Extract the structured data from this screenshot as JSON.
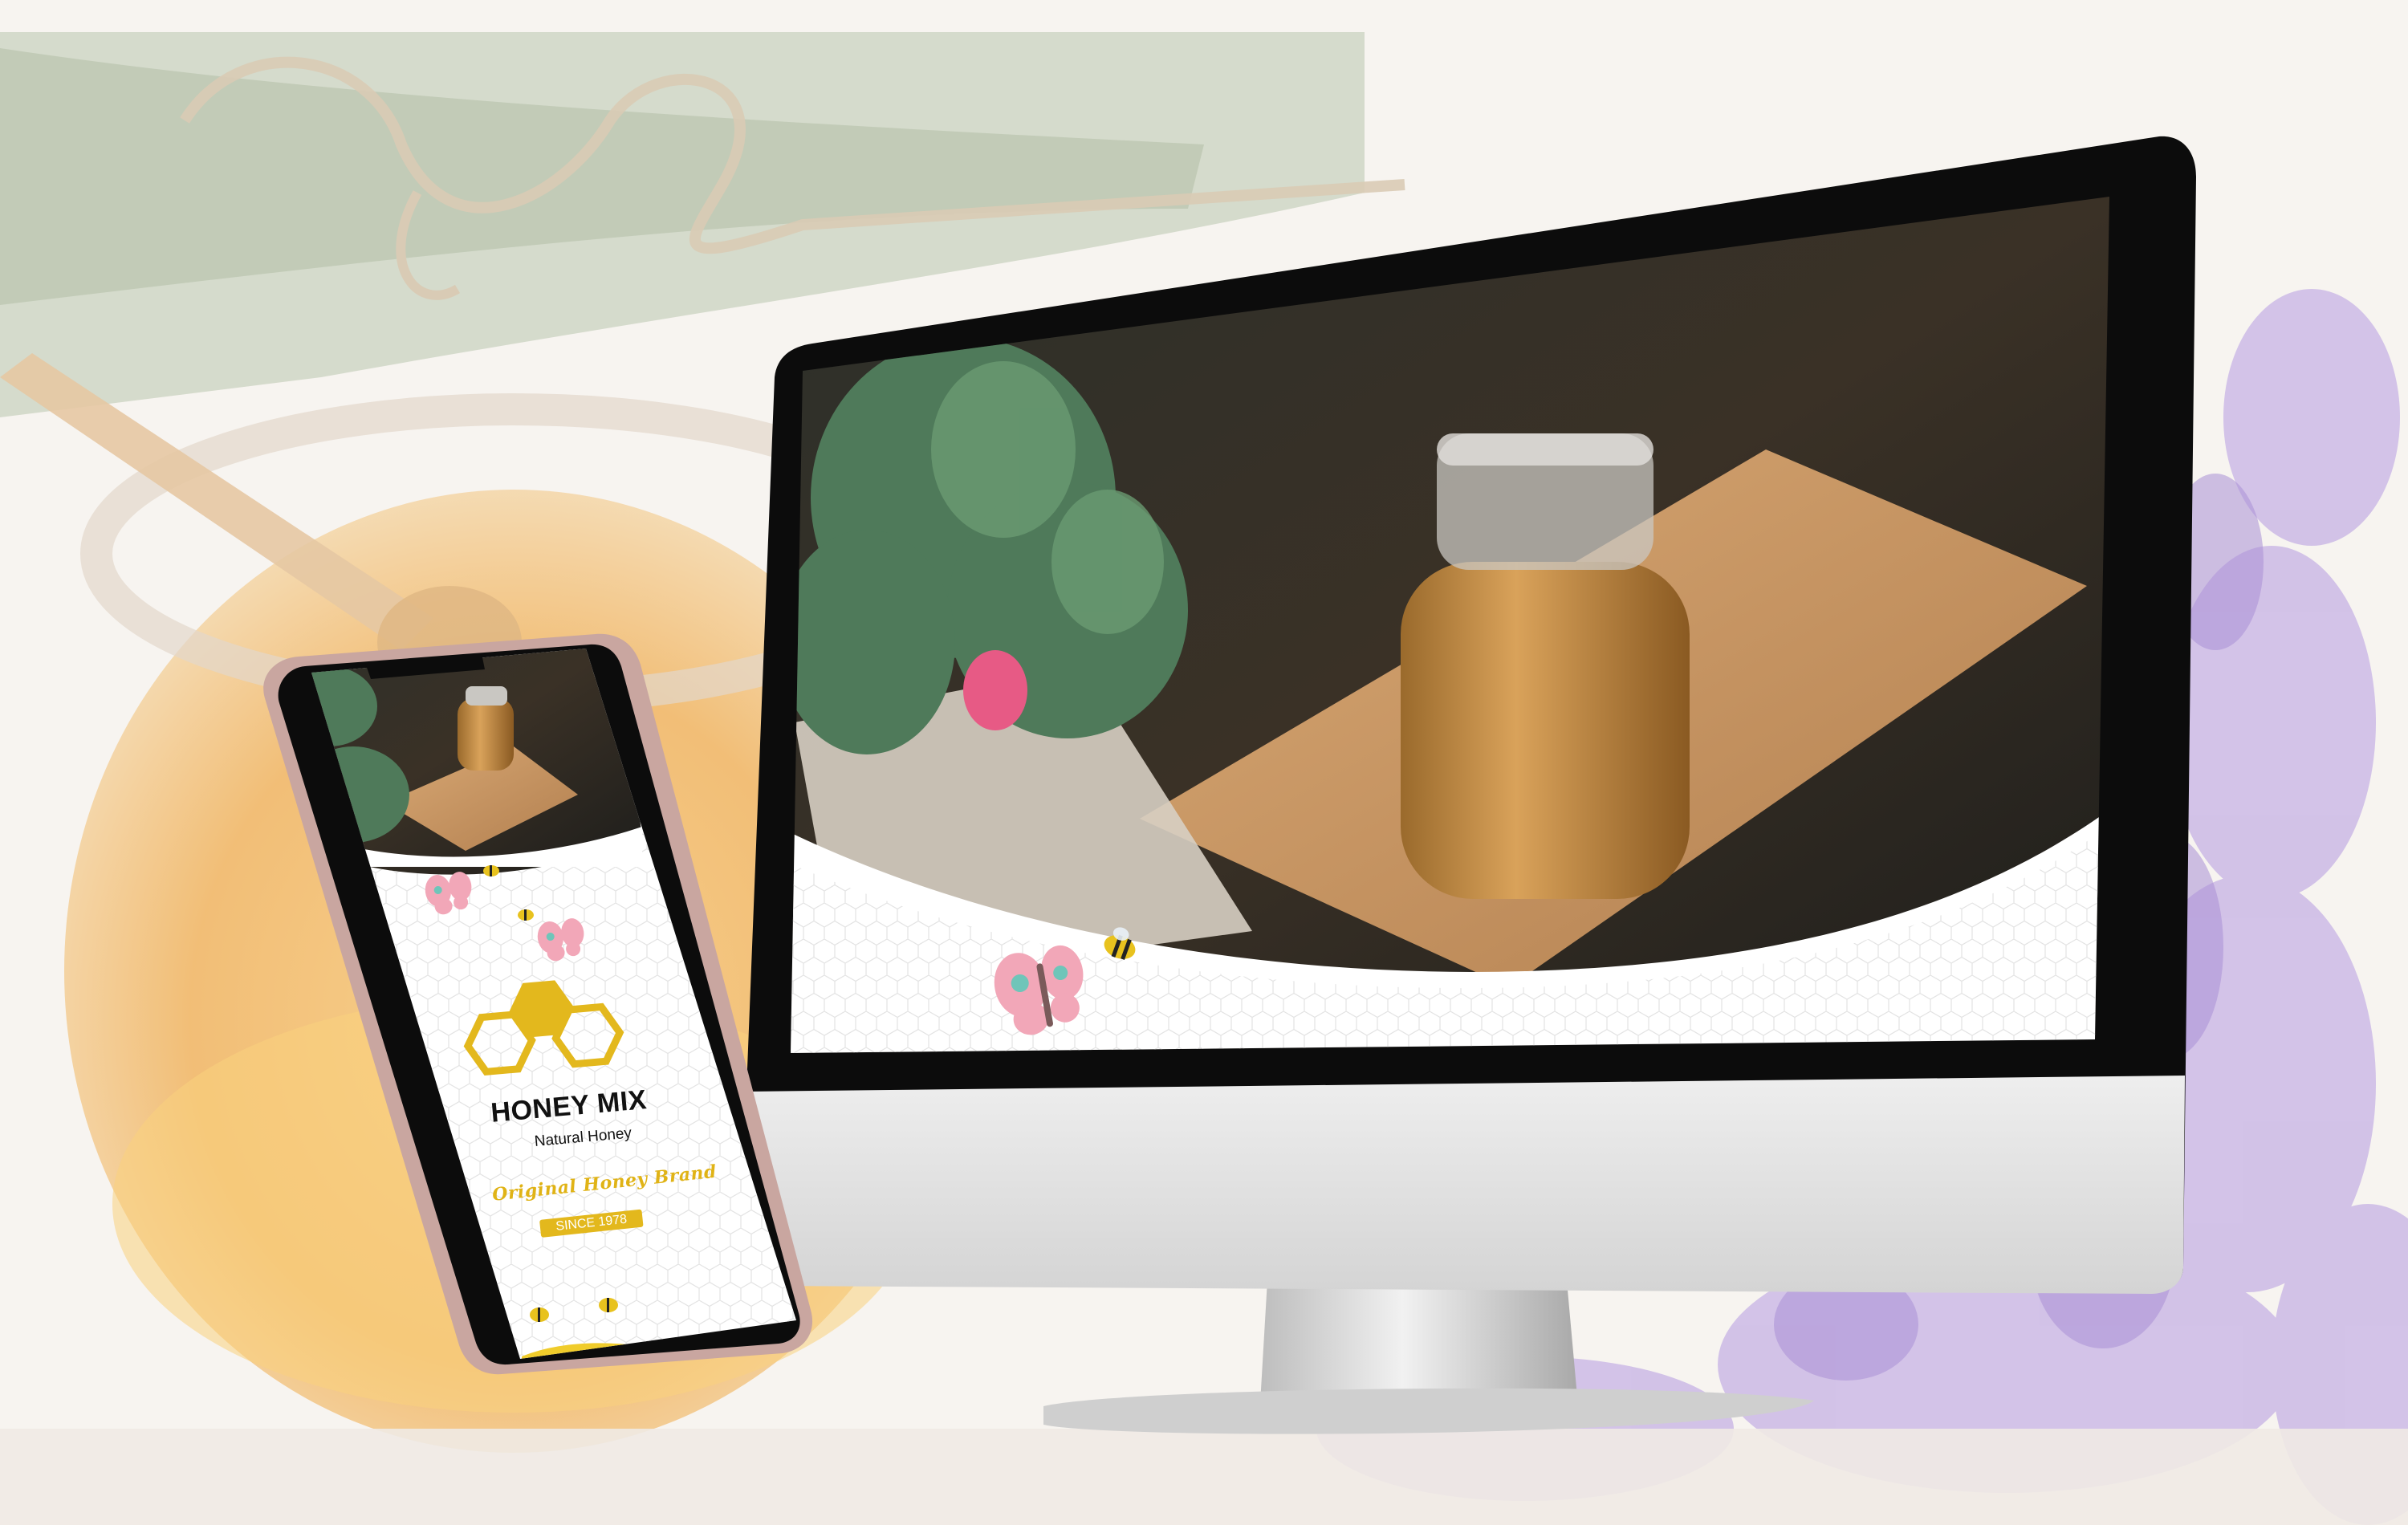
{
  "phone": {
    "brand_title": "HONEY MIX",
    "brand_subtitle": "Natural Honey",
    "tagline": "Original Honey Brand",
    "since_label": "SINCE 1978"
  },
  "colors": {
    "honey_yellow": "#e0b316",
    "badge_yellow": "#e3b81d",
    "lavender": "#b59ad8",
    "butterfly_pink": "#f2a7b8",
    "butterfly_teal": "#6fc5b9",
    "device_black": "#0c0c0c",
    "device_silver": "#dcdcdc",
    "phone_rose": "#c9a6a0"
  },
  "icons": [
    "butterfly-icon",
    "bee-icon",
    "honeycomb-logo-icon"
  ]
}
